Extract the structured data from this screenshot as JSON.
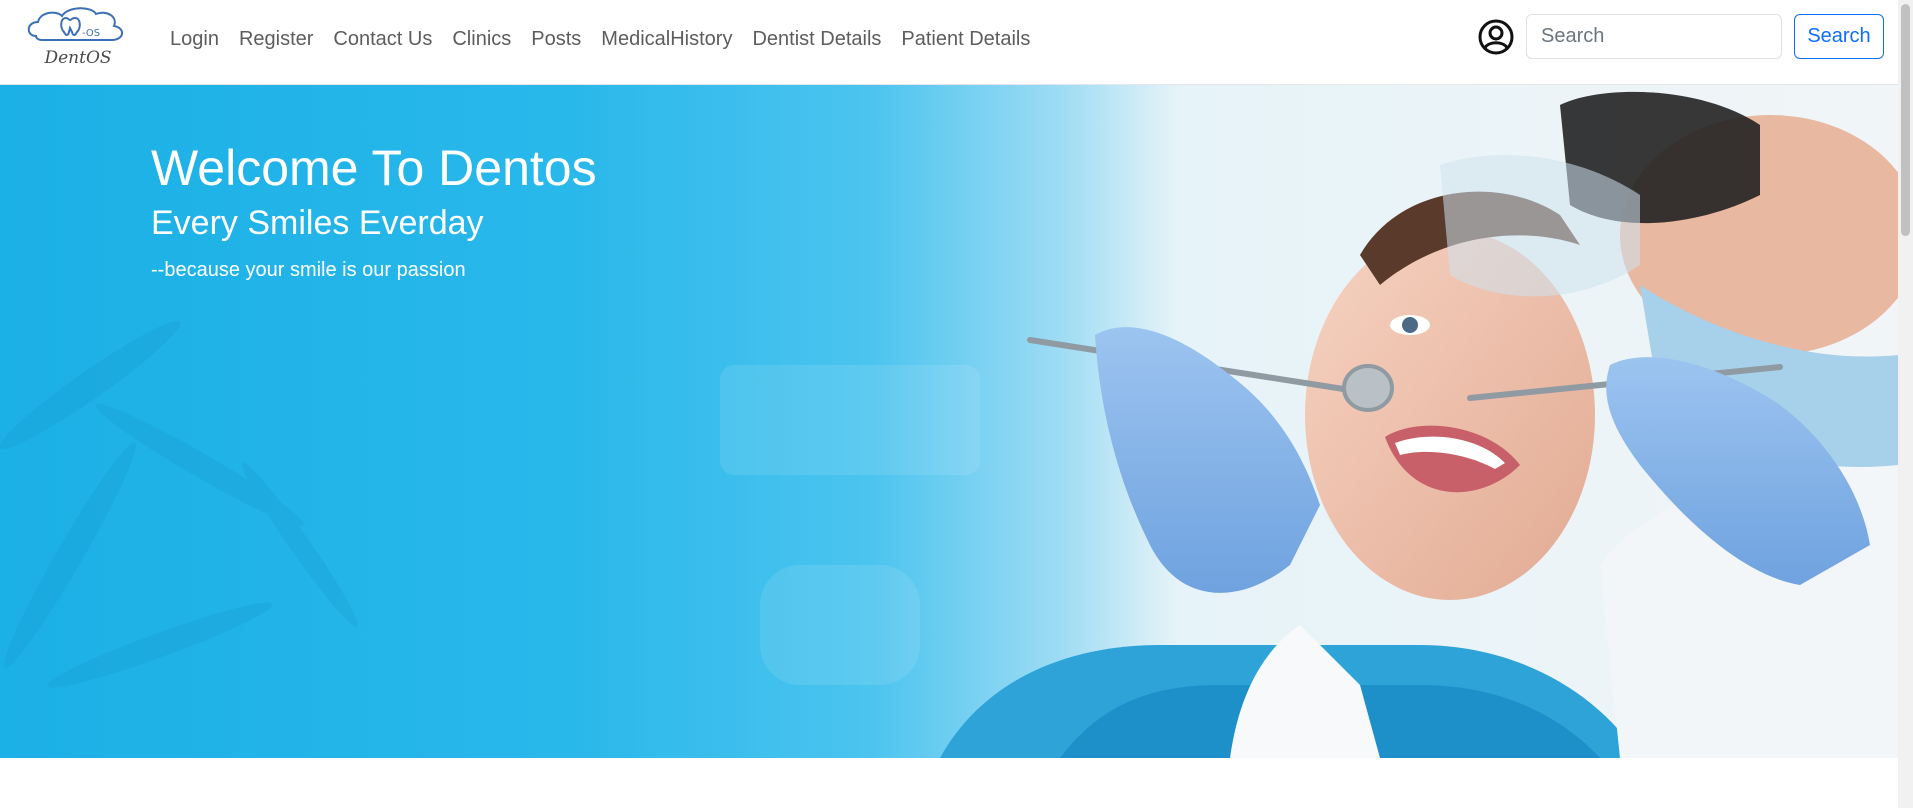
{
  "brand": {
    "name": "DentOS",
    "logo_mark": "-OS"
  },
  "nav": {
    "links": [
      "Login",
      "Register",
      "Contact Us",
      "Clinics",
      "Posts",
      "MedicalHistory",
      "Dentist Details",
      "Patient Details"
    ]
  },
  "user_icon": "user-circle-icon",
  "search": {
    "placeholder": "Search",
    "value": "",
    "button_label": "Search"
  },
  "hero": {
    "title": "Welcome To Dentos",
    "subtitle": "Every Smiles Everday",
    "tagline": "--because your smile is our passion",
    "image": "dentist-examining-smiling-patient"
  },
  "colors": {
    "accent": "#0d6efd",
    "hero_blue": "#1bb0e6",
    "nav_text": "#5d5d5d"
  }
}
